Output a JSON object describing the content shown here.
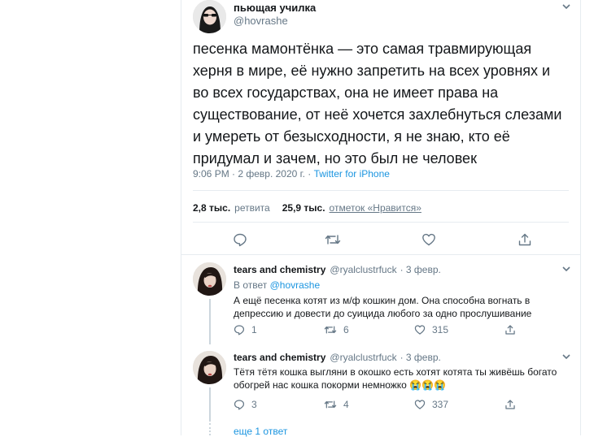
{
  "main_tweet": {
    "author_name": "пьющая училка",
    "author_handle": "@hovrashe",
    "text_lines": [
      "песенка мамонтёнка — это самая травмирующая",
      "херня в мире, её нужно запретить на всех уровнях и",
      "во всех государствах, она не имеет права на",
      "существование, от неё хочется захлебнуться слезами",
      "и умереть от безысходности, я не знаю, кто её",
      "придумал и зачем, но это был не человек"
    ],
    "timestamp": "9:06 PM · 2 февр. 2020 г. · ",
    "source": "Twitter for iPhone",
    "retweets_count": "2,8 тыс.",
    "retweets_label": "ретвита",
    "likes_count": "25,9 тыс.",
    "likes_label": "отметок «Нравится»"
  },
  "replies": [
    {
      "author_name": "tears and chemistry",
      "author_handle": "@ryalclustrfuck",
      "date": "· 3 февр.",
      "reply_to_prefix": "В ответ ",
      "reply_to_handle": "@hovrashe",
      "text_lines": [
        "А ещё песенка котят из м/ф кошкин дом. Она способна вогнать в",
        "депрессию и довести до суицида любого за одно прослушивание"
      ],
      "replies_count": "1",
      "retweets_count": "6",
      "likes_count": "315"
    },
    {
      "author_name": "tears and chemistry",
      "author_handle": "@ryalclustrfuck",
      "date": "· 3 февр.",
      "text_lines": [
        "Тётя тётя кошка выгляни в окошко есть хотят котята ты живёшь богато",
        "обогрей нас кошка покорми немножко 😭😭😭"
      ],
      "replies_count": "3",
      "retweets_count": "4",
      "likes_count": "337"
    }
  ],
  "more_replies": "еще 1 ответ",
  "icons": {
    "chevron": "chevron-down-icon",
    "reply": "reply-icon",
    "retweet": "retweet-icon",
    "like": "heart-icon",
    "share": "share-icon"
  },
  "colors": {
    "link": "#1b95e0",
    "muted": "#657786",
    "divider": "#e6ecf0"
  }
}
